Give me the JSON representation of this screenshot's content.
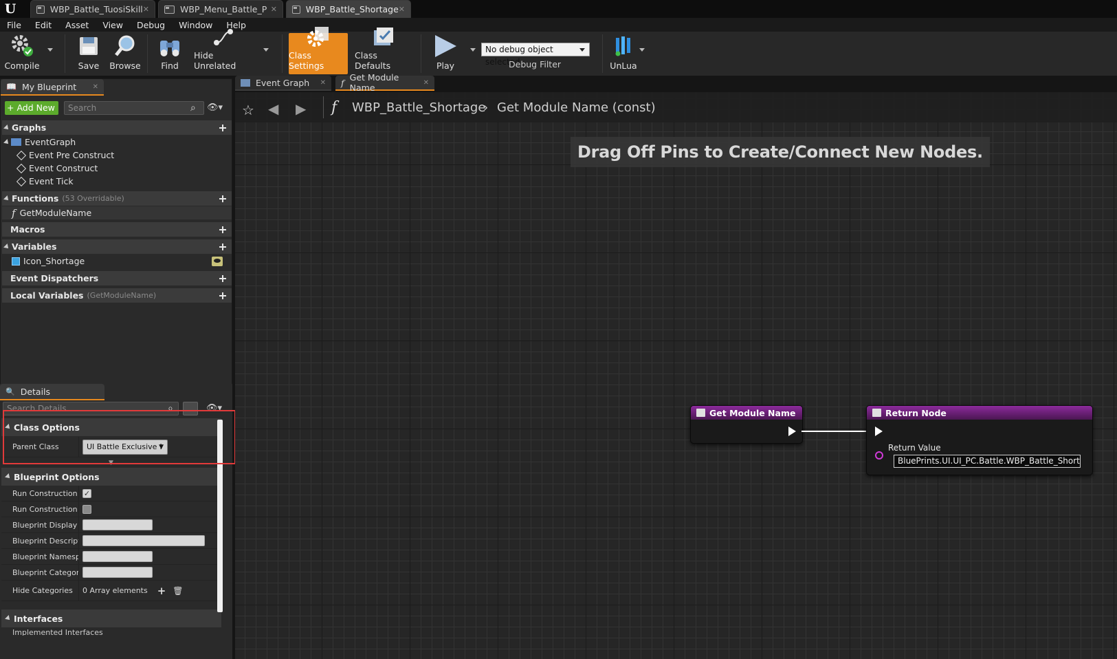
{
  "doc_tabs": [
    {
      "label": "WBP_Battle_TuosiSkill"
    },
    {
      "label": "WBP_Menu_Battle_P"
    },
    {
      "label": "WBP_Battle_Shortage"
    }
  ],
  "menu": [
    "File",
    "Edit",
    "Asset",
    "View",
    "Debug",
    "Window",
    "Help"
  ],
  "toolbar": {
    "compile": "Compile",
    "save": "Save",
    "browse": "Browse",
    "find": "Find",
    "hide_unrelated": "Hide Unrelated",
    "class_settings": "Class Settings",
    "class_defaults": "Class Defaults",
    "play": "Play",
    "debug_object": "No debug object selected",
    "debug_filter": "Debug Filter",
    "unlua": "UnLua"
  },
  "my_blueprint": {
    "tab": "My Blueprint",
    "add_new": "Add New",
    "search_placeholder": "Search",
    "graphs_label": "Graphs",
    "graphs": [
      "EventGraph",
      "Event Pre Construct",
      "Event Construct",
      "Event Tick"
    ],
    "functions_label": "Functions",
    "functions_note": "(53 Overridable)",
    "functions": [
      "GetModuleName"
    ],
    "macros_label": "Macros",
    "variables_label": "Variables",
    "variables": [
      "Icon_Shortage"
    ],
    "dispatchers_label": "Event Dispatchers",
    "local_vars_label": "Local Variables",
    "local_vars_note": "(GetModuleName)"
  },
  "details": {
    "tab": "Details",
    "search_placeholder": "Search Details",
    "class_options": "Class Options",
    "parent_class_label": "Parent Class",
    "parent_class_value": "UI Battle Exclusive !",
    "blueprint_options": "Blueprint Options",
    "rows": [
      {
        "label": "Run Construction S",
        "kind": "check",
        "checked": true
      },
      {
        "label": "Run Construction S",
        "kind": "check",
        "checked": false
      },
      {
        "label": "Blueprint Display N",
        "kind": "text"
      },
      {
        "label": "Blueprint Descriptio",
        "kind": "text"
      },
      {
        "label": "Blueprint Namespa",
        "kind": "text"
      },
      {
        "label": "Blueprint Category",
        "kind": "text"
      }
    ],
    "hide_categories_label": "Hide Categories",
    "hide_categories_value": "0 Array elements",
    "interfaces": "Interfaces",
    "implemented_interfaces": "Implemented Interfaces"
  },
  "graph": {
    "tabs": [
      "Event Graph",
      "Get Module Name"
    ],
    "crumb_blueprint": "WBP_Battle_Shortage",
    "crumb_function": "Get Module Name (const)",
    "hint": "Drag Off Pins to Create/Connect New Nodes.",
    "entry_node": "Get Module Name",
    "return_node": "Return Node",
    "return_value_label": "Return Value",
    "return_value": "BluePrints.UI.UI_PC.Battle.WBP_Battle_Shortage_C"
  },
  "colors": {
    "accent": "#e8891e",
    "add_new": "#5cab2c",
    "function_node": "#8c2b9c",
    "highlight_box": "#e23a3a"
  }
}
